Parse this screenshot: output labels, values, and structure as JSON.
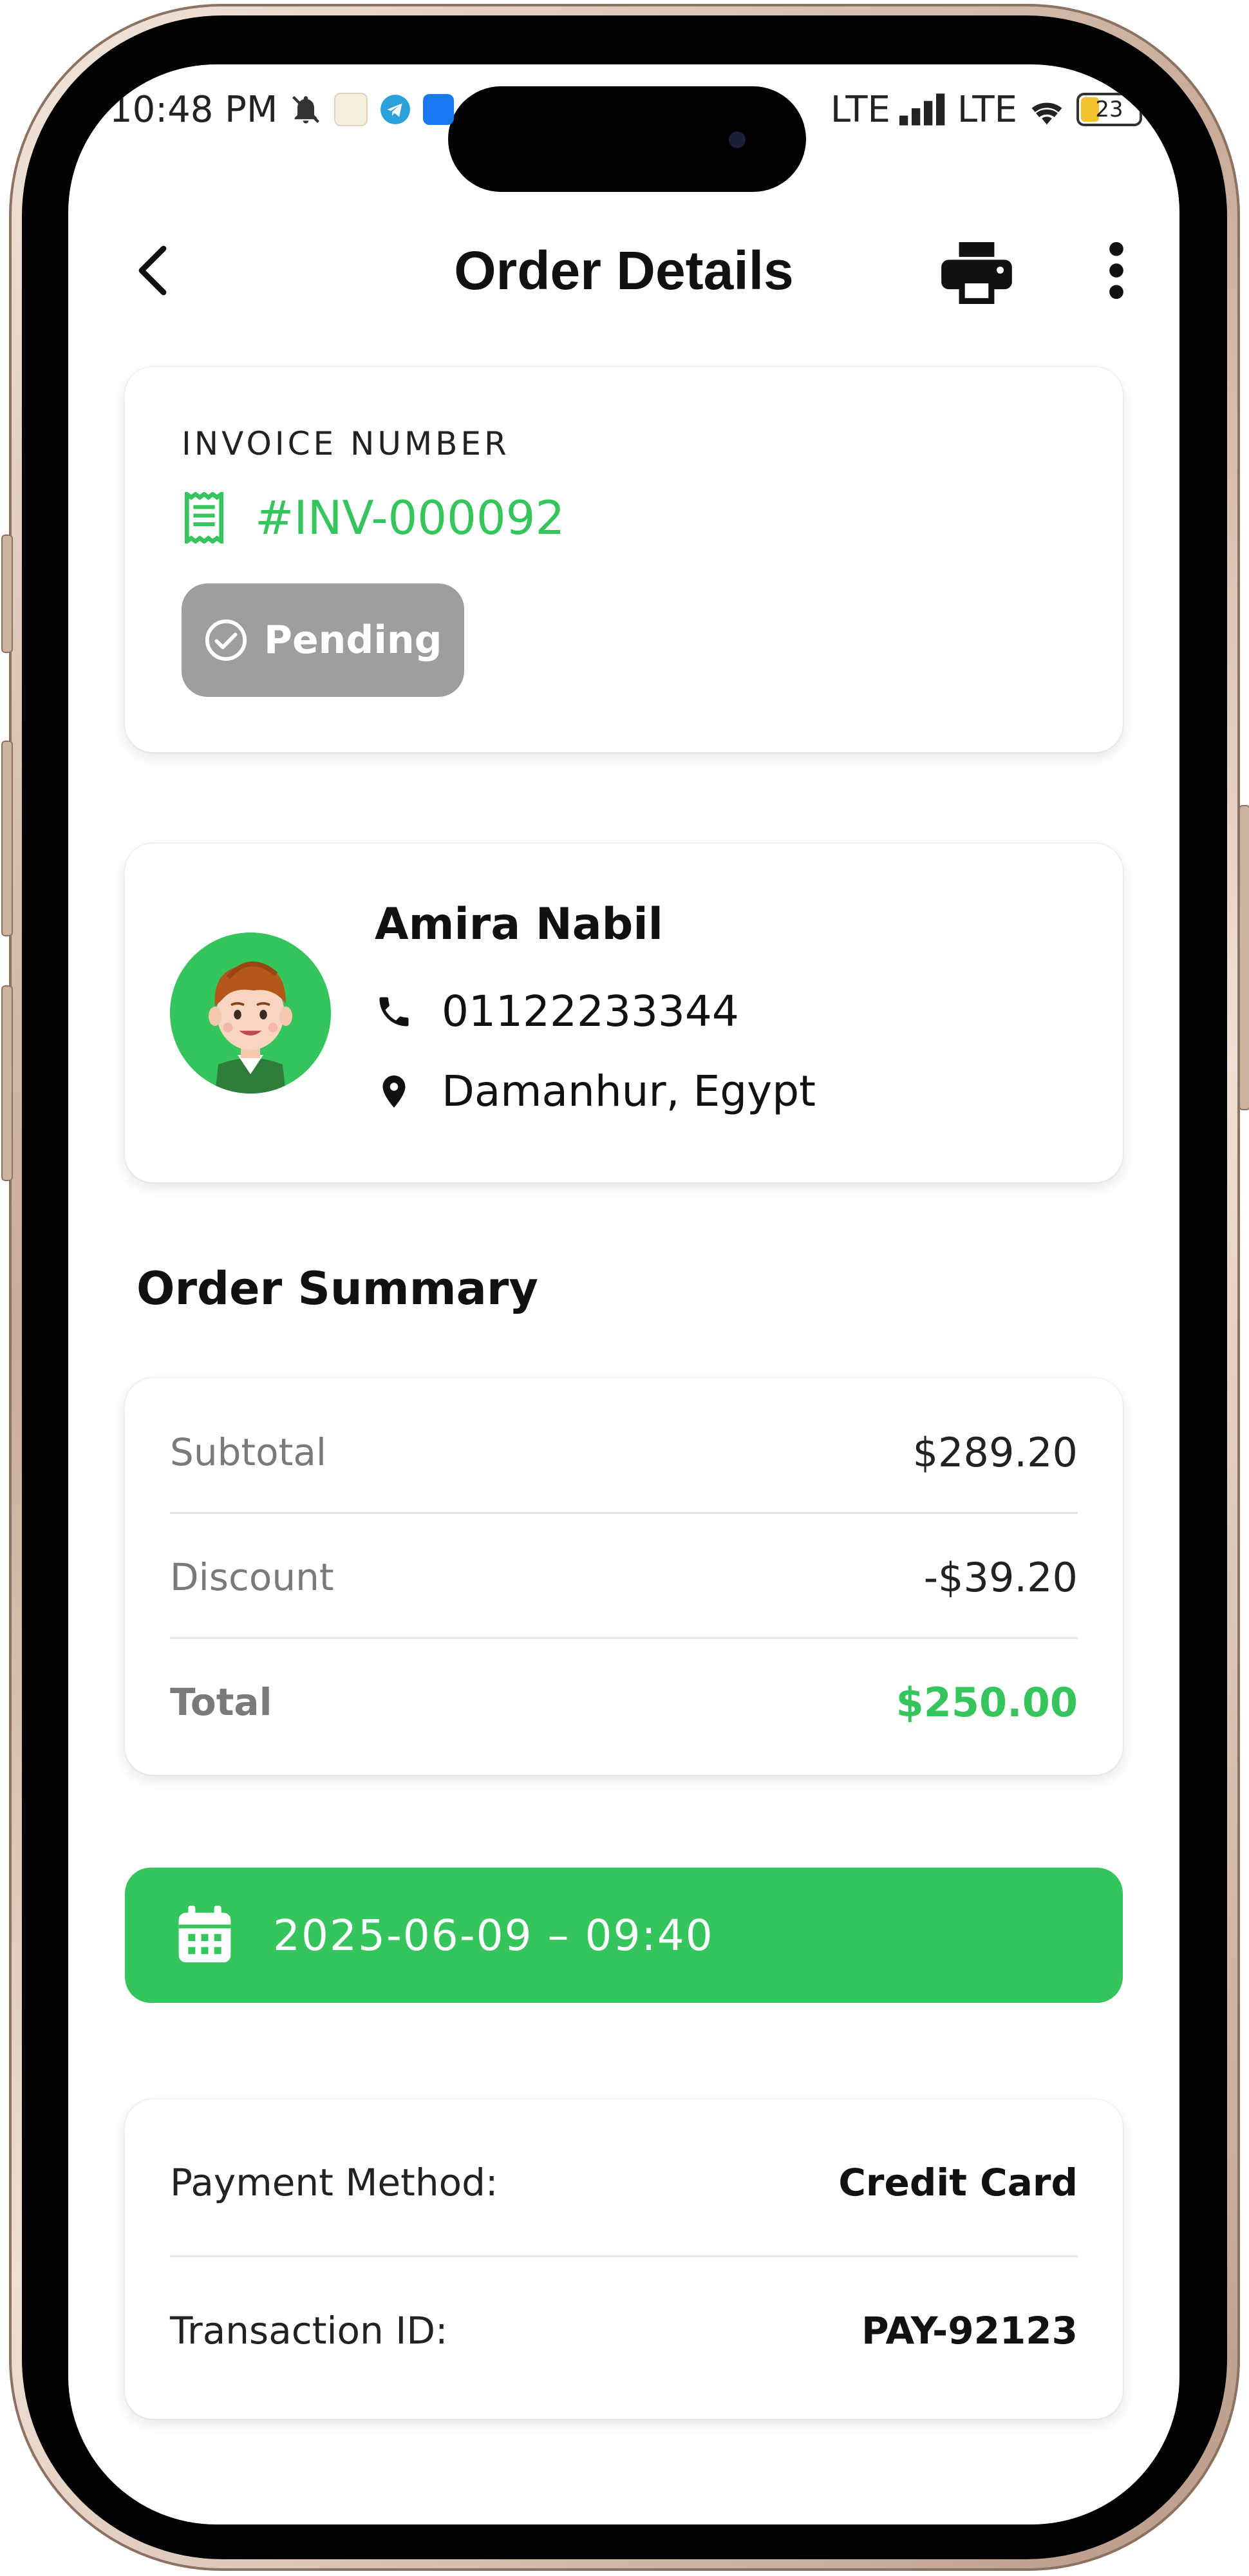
{
  "status_bar": {
    "time": "10:48 PM",
    "network_1": "LTE",
    "network_2": "LTE",
    "battery_level": "23"
  },
  "app_bar": {
    "title": "Order Details",
    "icons": [
      "back-arrow-icon",
      "printer-icon",
      "more-vertical-icon"
    ]
  },
  "invoice": {
    "label": "INVOICE NUMBER",
    "number": "#INV-000092",
    "status": "Pending"
  },
  "customer": {
    "name": "Amira Nabil",
    "phone": "01122233344",
    "location": "Damanhur, Egypt"
  },
  "order_summary": {
    "title": "Order Summary",
    "rows": [
      {
        "label": "Subtotal",
        "value": "$289.20"
      },
      {
        "label": "Discount",
        "value": "-$39.20"
      },
      {
        "label": "Total",
        "value": "$250.00"
      }
    ]
  },
  "order_date": "2025-06-09 – 09:40",
  "payment": {
    "rows": [
      {
        "label": "Payment Method:",
        "value": "Credit Card"
      },
      {
        "label": "Transaction ID:",
        "value": "PAY-92123"
      }
    ]
  },
  "colors": {
    "accent_green": "#36c45c",
    "pending_gray": "#9e9e9e"
  }
}
